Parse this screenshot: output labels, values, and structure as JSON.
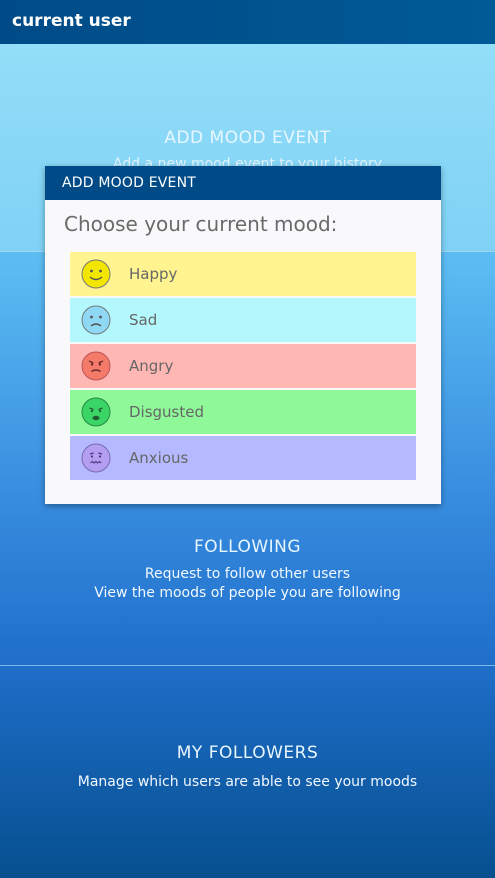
{
  "topbar": {
    "title": "current user"
  },
  "sections": {
    "add_mood": {
      "title": "ADD MOOD EVENT",
      "desc": "Add a new mood event to your history"
    },
    "following": {
      "title": "FOLLOWING",
      "desc_a": "Request to follow other users",
      "desc_b": "View the moods of people you are following"
    },
    "followers": {
      "title": "MY FOLLOWERS",
      "desc": "Manage which users are able to see your moods"
    }
  },
  "dialog": {
    "title": "ADD MOOD EVENT",
    "question": "Choose your current mood:",
    "moods": [
      {
        "label": "Happy",
        "bg": "#fff48f",
        "face": "#f2e600",
        "icon": "happy-face-icon"
      },
      {
        "label": "Sad",
        "bg": "#b3f8fc",
        "face": "#8fd8f3",
        "icon": "sad-face-icon"
      },
      {
        "label": "Angry",
        "bg": "#ffb7b4",
        "face": "#f47b6a",
        "icon": "angry-face-icon"
      },
      {
        "label": "Disgusted",
        "bg": "#8ff99a",
        "face": "#3ad566",
        "icon": "disgusted-face-icon"
      },
      {
        "label": "Anxious",
        "bg": "#b5b9ff",
        "face": "#b39ef2",
        "icon": "anxious-face-icon"
      }
    ]
  }
}
